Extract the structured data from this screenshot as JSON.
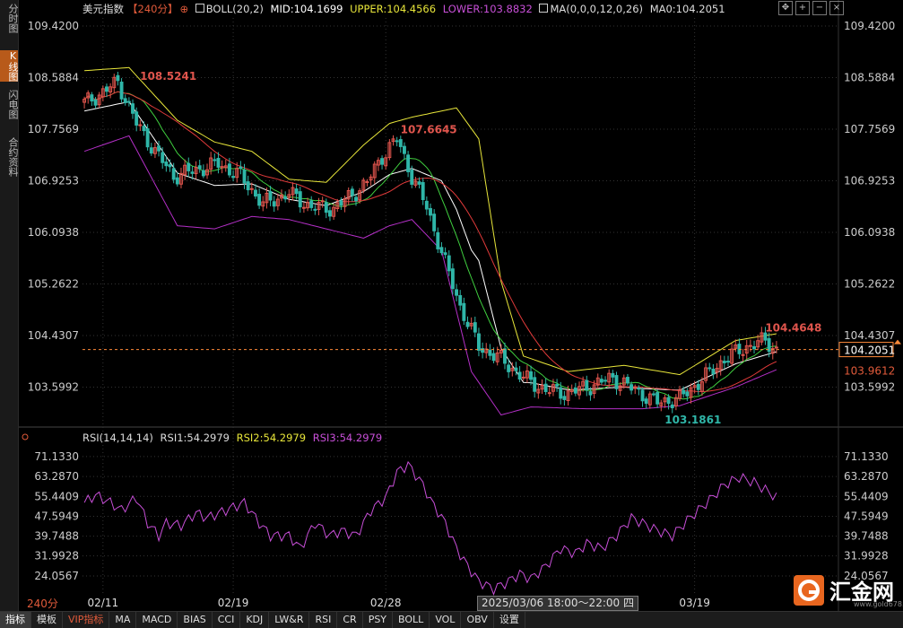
{
  "side_tabs": [
    {
      "label": "分时图",
      "active": false
    },
    {
      "label": "K线图",
      "active": true
    },
    {
      "label": "闪电图",
      "active": false
    },
    {
      "label": "合约资料",
      "active": false
    }
  ],
  "legend": {
    "name": "美元指数",
    "period": "【240分】",
    "boll": "BOLL(20,2)",
    "mid": "MID:104.1699",
    "upper": "UPPER:104.4566",
    "lower": "LOWER:103.8832",
    "ma": "MA(0,0,0,12,0,26)",
    "ma0": "MA0:104.2051"
  },
  "rsi_legend": {
    "rsi": "RSI(14,14,14)",
    "rsi1": "RSI1:54.2979",
    "rsi2": "RSI2:54.2979",
    "rsi3": "RSI3:54.2979"
  },
  "toolbar_icons": [
    "crosshair-expand-icon",
    "zoom-in-icon",
    "zoom-out-icon",
    "close-icon"
  ],
  "bottom_tabs": [
    {
      "label": "指标",
      "active": true,
      "vip": false
    },
    {
      "label": "模板",
      "active": false,
      "vip": false
    },
    {
      "label": "VIP指标",
      "active": false,
      "vip": true
    },
    {
      "label": "MA",
      "active": false,
      "vip": false
    },
    {
      "label": "MACD",
      "active": false,
      "vip": false
    },
    {
      "label": "BIAS",
      "active": false,
      "vip": false
    },
    {
      "label": "CCI",
      "active": false,
      "vip": false
    },
    {
      "label": "KDJ",
      "active": false,
      "vip": false
    },
    {
      "label": "LW&R",
      "active": false,
      "vip": false
    },
    {
      "label": "RSI",
      "active": false,
      "vip": false
    },
    {
      "label": "CR",
      "active": false,
      "vip": false
    },
    {
      "label": "PSY",
      "active": false,
      "vip": false
    },
    {
      "label": "BOLL",
      "active": false,
      "vip": false
    },
    {
      "label": "VOL",
      "active": false,
      "vip": false
    },
    {
      "label": "OBV",
      "active": false,
      "vip": false
    },
    {
      "label": "设置",
      "active": false,
      "vip": false
    }
  ],
  "period_label": "240分",
  "crosshair_date": "2025/03/06 18:00～22:00 四",
  "logo_text": "汇金网",
  "logo_url": "www.gold678.com",
  "colors": {
    "up": "#e0554d",
    "down": "#2fb6a8",
    "upper": "#e8e63a",
    "lower": "#b42fc7",
    "mid": "#ffffff",
    "ma12": "#3fcf3f",
    "ma26": "#e03a3a",
    "rsi": "#c84fd8",
    "grid": "#333333",
    "price_line": "#ff8a3a"
  },
  "chart_data": [
    {
      "type": "candlestick",
      "title": "美元指数 240分",
      "y_ticks": [
        "109.4200",
        "108.5884",
        "107.7569",
        "106.9253",
        "106.0938",
        "105.2622",
        "104.4307",
        "103.5992"
      ],
      "ylim": [
        103.1,
        109.55
      ],
      "x_labels": [
        "02/11",
        "02/19",
        "02/28",
        "03/19"
      ],
      "x_label_index": [
        5,
        40,
        81,
        164
      ],
      "candle_count": 187,
      "anchors": [
        [
          0,
          108.18
        ],
        [
          5,
          108.35
        ],
        [
          9,
          108.52
        ],
        [
          14,
          107.85
        ],
        [
          19,
          107.4
        ],
        [
          24,
          107.0
        ],
        [
          30,
          107.1
        ],
        [
          36,
          107.2
        ],
        [
          42,
          107.0
        ],
        [
          48,
          106.55
        ],
        [
          55,
          106.72
        ],
        [
          61,
          106.5
        ],
        [
          67,
          106.48
        ],
        [
          71,
          106.65
        ],
        [
          76,
          106.9
        ],
        [
          80,
          107.32
        ],
        [
          84,
          107.6
        ],
        [
          88,
          107.0
        ],
        [
          92,
          106.5
        ],
        [
          97,
          105.6
        ],
        [
          101,
          104.9
        ],
        [
          106,
          104.25
        ],
        [
          112,
          104.05
        ],
        [
          118,
          103.75
        ],
        [
          124,
          103.55
        ],
        [
          130,
          103.5
        ],
        [
          136,
          103.62
        ],
        [
          142,
          103.75
        ],
        [
          148,
          103.55
        ],
        [
          154,
          103.35
        ],
        [
          160,
          103.42
        ],
        [
          166,
          103.72
        ],
        [
          172,
          104.05
        ],
        [
          178,
          104.25
        ],
        [
          183,
          104.35
        ],
        [
          186,
          104.2
        ]
      ],
      "last_close": 104.2051,
      "annotations": [
        {
          "label": "108.5241",
          "value": 108.5241,
          "index": 14
        },
        {
          "label": "107.6645",
          "value": 107.6645,
          "index": 84
        },
        {
          "label": "104.4648",
          "value": 104.4648,
          "index": 182
        },
        {
          "label": "103.1861",
          "value": 103.1861,
          "index": 155
        }
      ],
      "price_tags": [
        "104.2051",
        "103.9612"
      ],
      "series": [
        {
          "name": "UPPER",
          "anchors": [
            [
              0,
              108.7
            ],
            [
              12,
              108.75
            ],
            [
              25,
              107.9
            ],
            [
              35,
              107.55
            ],
            [
              45,
              107.4
            ],
            [
              55,
              106.95
            ],
            [
              65,
              106.9
            ],
            [
              75,
              107.5
            ],
            [
              82,
              107.85
            ],
            [
              88,
              107.95
            ],
            [
              100,
              108.1
            ],
            [
              106,
              107.6
            ],
            [
              112,
              105.3
            ],
            [
              118,
              104.1
            ],
            [
              130,
              103.85
            ],
            [
              145,
              103.95
            ],
            [
              160,
              103.8
            ],
            [
              175,
              104.35
            ],
            [
              186,
              104.46
            ]
          ]
        },
        {
          "name": "LOWER",
          "anchors": [
            [
              0,
              107.4
            ],
            [
              12,
              107.65
            ],
            [
              25,
              106.2
            ],
            [
              35,
              106.15
            ],
            [
              45,
              106.35
            ],
            [
              55,
              106.3
            ],
            [
              65,
              106.15
            ],
            [
              75,
              106.0
            ],
            [
              82,
              106.2
            ],
            [
              88,
              106.3
            ],
            [
              96,
              105.8
            ],
            [
              104,
              103.85
            ],
            [
              112,
              103.15
            ],
            [
              120,
              103.28
            ],
            [
              135,
              103.25
            ],
            [
              150,
              103.25
            ],
            [
              160,
              103.3
            ],
            [
              175,
              103.6
            ],
            [
              186,
              103.88
            ]
          ]
        }
      ]
    },
    {
      "type": "line",
      "title": "RSI(14,14,14)",
      "y_ticks": [
        "71.1330",
        "63.2870",
        "55.4409",
        "47.5949",
        "39.7488",
        "31.9928",
        "24.0567"
      ],
      "ylim": [
        17.0,
        75.0
      ],
      "series": [
        {
          "name": "RSI1",
          "anchors": [
            [
              0,
              53
            ],
            [
              3,
              56
            ],
            [
              7,
              53
            ],
            [
              10,
              50
            ],
            [
              14,
              55
            ],
            [
              17,
              45
            ],
            [
              20,
              40
            ],
            [
              22,
              45
            ],
            [
              26,
              44
            ],
            [
              30,
              49
            ],
            [
              33,
              47
            ],
            [
              38,
              50
            ],
            [
              43,
              53
            ],
            [
              47,
              45
            ],
            [
              50,
              40
            ],
            [
              55,
              40
            ],
            [
              58,
              35
            ],
            [
              62,
              45
            ],
            [
              66,
              40
            ],
            [
              69,
              42
            ],
            [
              73,
              40
            ],
            [
              77,
              50
            ],
            [
              81,
              55
            ],
            [
              84,
              65
            ],
            [
              87,
              68
            ],
            [
              89,
              64
            ],
            [
              91,
              60
            ],
            [
              93,
              54
            ],
            [
              97,
              45
            ],
            [
              100,
              35
            ],
            [
              103,
              28
            ],
            [
              106,
              22
            ],
            [
              110,
              19
            ],
            [
              114,
              22
            ],
            [
              117,
              25
            ],
            [
              120,
              23
            ],
            [
              124,
              28
            ],
            [
              128,
              35
            ],
            [
              132,
              33
            ],
            [
              135,
              37
            ],
            [
              139,
              35
            ],
            [
              143,
              40
            ],
            [
              147,
              47
            ],
            [
              150,
              45
            ],
            [
              154,
              42
            ],
            [
              158,
              40
            ],
            [
              162,
              46
            ],
            [
              165,
              50
            ],
            [
              168,
              54
            ],
            [
              172,
              60
            ],
            [
              176,
              63
            ],
            [
              180,
              61
            ],
            [
              183,
              58
            ],
            [
              186,
              55
            ]
          ]
        },
        {
          "name": "RSI2",
          "anchors": []
        },
        {
          "name": "RSI3",
          "anchors": []
        }
      ]
    }
  ]
}
